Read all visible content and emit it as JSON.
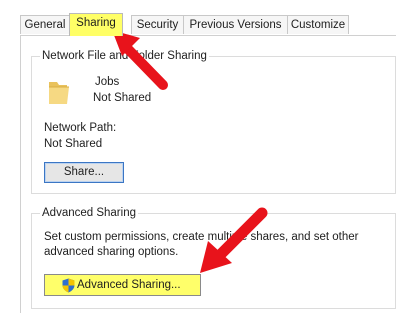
{
  "tabs": [
    {
      "label": "General",
      "active": false
    },
    {
      "label": "Sharing",
      "active": true
    },
    {
      "label": "Security",
      "active": false
    },
    {
      "label": "Previous Versions",
      "active": false
    },
    {
      "label": "Customize",
      "active": false
    }
  ],
  "network_sharing": {
    "title": "Network File and Folder Sharing",
    "folder_name": "Jobs",
    "folder_status": "Not Shared",
    "network_path_label": "Network Path:",
    "network_path_value": "Not Shared",
    "share_button": "Share..."
  },
  "advanced_sharing": {
    "title": "Advanced Sharing",
    "description_line1": "Set custom permissions, create multiple shares, and set other",
    "description_line2": "advanced sharing options.",
    "button_label": "Advanced Sharing..."
  },
  "colors": {
    "highlight": "#ffff66",
    "arrow": "#e8131b",
    "shield_blue": "#2f6fd0",
    "shield_yellow": "#f5c400",
    "folder": "#f2d27a"
  },
  "icons": [
    "folder-icon",
    "uac-shield-icon",
    "red-arrow-annotation"
  ]
}
